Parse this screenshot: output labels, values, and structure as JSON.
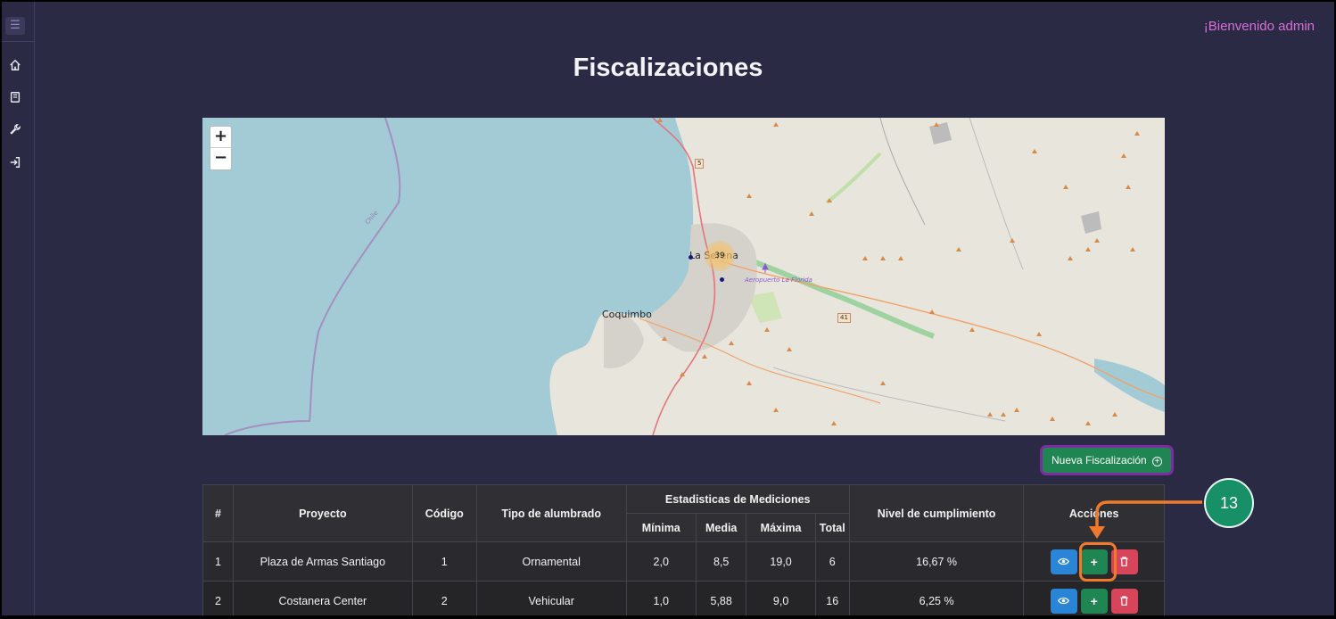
{
  "header": {
    "welcome": "¡Bienvenido admin"
  },
  "page": {
    "title": "Fiscalizaciones"
  },
  "sidebar": {
    "items": [
      {
        "icon": "home-icon"
      },
      {
        "icon": "book-icon"
      },
      {
        "icon": "wrench-icon"
      },
      {
        "icon": "logout-icon"
      }
    ]
  },
  "map": {
    "zoom_in": "+",
    "zoom_out": "−",
    "labels": {
      "coquimbo": "Coquimbo",
      "la_serena": "La Serena",
      "airport": "Aeropuerto La Florida",
      "chile": "Chile"
    },
    "cluster_count": "39",
    "routes": [
      "5",
      "41"
    ]
  },
  "actions": {
    "new_button": "Nueva Fiscalización"
  },
  "table": {
    "headers": {
      "num": "#",
      "project": "Proyecto",
      "code": "Código",
      "lighting_type": "Tipo de alumbrado",
      "stats": "Estadisticas de Mediciones",
      "min": "Mínima",
      "mean": "Media",
      "max": "Máxima",
      "total": "Total",
      "compliance": "Nivel de cumplimiento",
      "actions": "Acciones"
    },
    "rows": [
      {
        "num": "1",
        "project": "Plaza de Armas Santiago",
        "code": "1",
        "type": "Ornamental",
        "min": "2,0",
        "mean": "8,5",
        "max": "19,0",
        "total": "6",
        "compliance": "16,67 %"
      },
      {
        "num": "2",
        "project": "Costanera Center",
        "code": "2",
        "type": "Vehicular",
        "min": "1,0",
        "mean": "5,88",
        "max": "9,0",
        "total": "16",
        "compliance": "6,25 %"
      }
    ],
    "row_buttons": {
      "add": "+"
    }
  },
  "annotation": {
    "step": "13",
    "color": "#f07a2a"
  }
}
